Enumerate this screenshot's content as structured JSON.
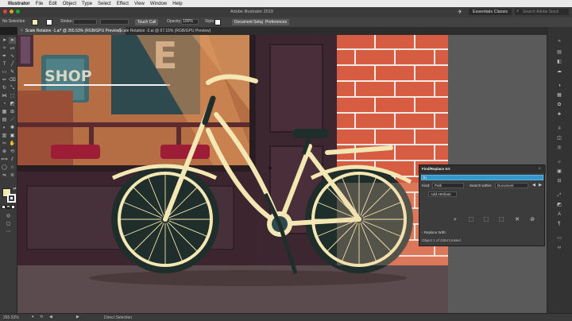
{
  "menubar": {
    "items": [
      "Illustrator",
      "File",
      "Edit",
      "Object",
      "Type",
      "Select",
      "Effect",
      "View",
      "Window",
      "Help"
    ]
  },
  "titlebar": {
    "title": "Adobe Illustrator 2019",
    "workspace": "Essentials Classic",
    "search_placeholder": "Search Adobe Stock"
  },
  "controlbar": {
    "selection": "No Selection",
    "stroke_label": "Stroke:",
    "brush_label": "Touch Call",
    "opacity_label": "Opacity:",
    "opacity_value": "100%",
    "style_label": "Style:",
    "document_setup": "Document Setup",
    "preferences": "Preferences"
  },
  "tabs": [
    {
      "label": "Scale Rotation -1.ai* @ 265.53% (RGB/GPU Preview)",
      "active": true
    },
    {
      "label": "Scale Rotation -2.ai @ 67.15% (RGB/GPU Preview)",
      "active": false
    }
  ],
  "artwork": {
    "shop_sign": "SHOP",
    "letter": "E"
  },
  "find_panel": {
    "title": "Find/Replace Art",
    "query": "fu",
    "kind_label": "Kind:",
    "kind_value": "Path",
    "search_within_label": "Search within:",
    "search_within_value": "Document",
    "add_attribute": "Add Attribute",
    "replace_with": "Replace With:",
    "status": "Object 1 of 2264 located"
  },
  "status": {
    "zoom": "265.53%",
    "tool": "Direct Selection"
  },
  "colors": {
    "fill": "#f3e8b3",
    "stroke": "#ffffff",
    "accent": "#3399cc",
    "brick": "#d2583f",
    "bike_frame": "#f3e8b3"
  }
}
